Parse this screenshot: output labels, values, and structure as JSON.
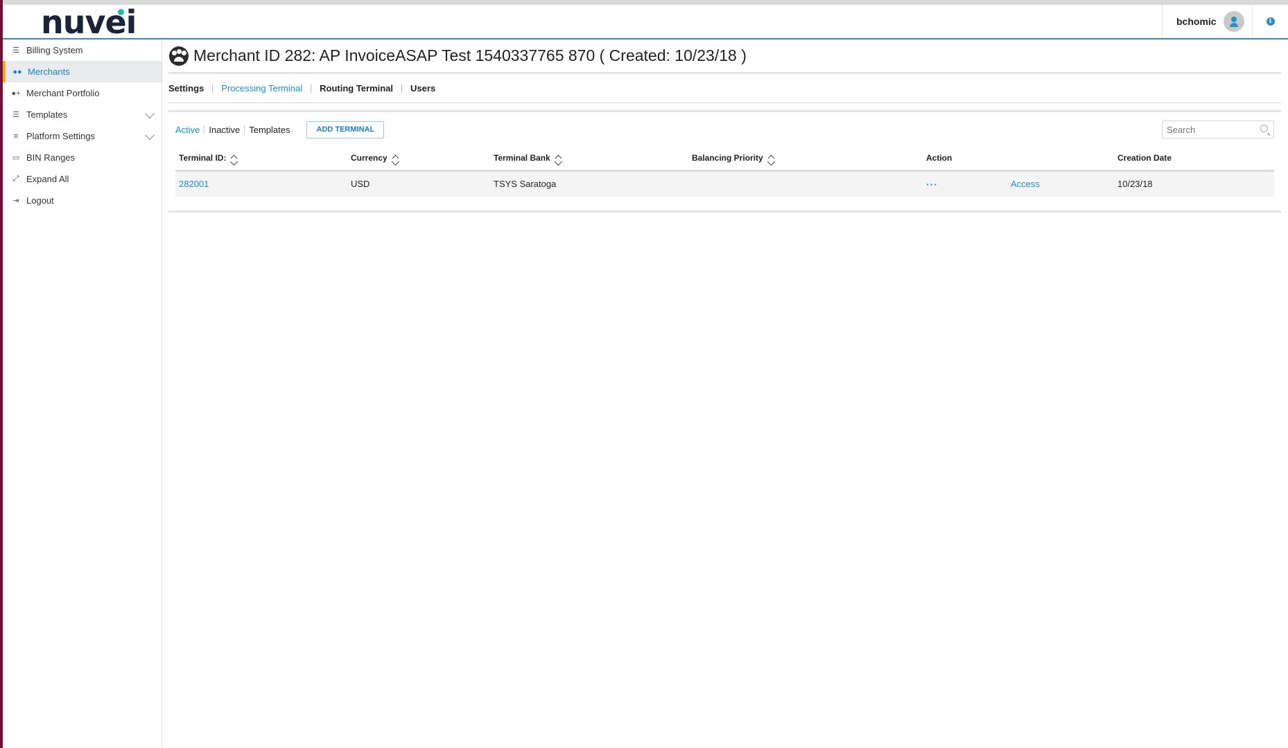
{
  "header": {
    "logo_text": "nuvei",
    "username": "bchomic",
    "info_glyph": "i"
  },
  "colors": {
    "accent": "#1a8fcf",
    "header_border": "#2a8fc7",
    "active_marker": "#f5a623",
    "logo_dark": "#1a2338",
    "logo_dot": "#26b7b0",
    "left_edge": "#6b1436"
  },
  "sidebar": {
    "items": [
      {
        "label": "Billing System",
        "icon": "list-icon"
      },
      {
        "label": "Merchants",
        "icon": "users-icon",
        "active": true
      },
      {
        "label": "Merchant Portfolio",
        "icon": "user-plus-icon"
      },
      {
        "label": "Templates",
        "icon": "list-icon",
        "expandable": true
      },
      {
        "label": "Platform Settings",
        "icon": "sliders-icon",
        "expandable": true
      },
      {
        "label": "BIN Ranges",
        "icon": "credit-card-icon"
      },
      {
        "label": "Expand All",
        "icon": "expand-icon"
      },
      {
        "label": "Logout",
        "icon": "logout-icon"
      }
    ]
  },
  "main": {
    "title": "Merchant ID 282: AP InvoiceASAP Test 1540337765 870 ( Created: 10/23/18 )",
    "tabs": [
      {
        "label": "Settings"
      },
      {
        "label": "Processing Terminal",
        "active": true
      },
      {
        "label": "Routing Terminal"
      },
      {
        "label": "Users"
      }
    ],
    "filters": [
      {
        "label": "Active",
        "active": true
      },
      {
        "label": "Inactive"
      },
      {
        "label": "Templates"
      }
    ],
    "add_button": "ADD TERMINAL",
    "search_placeholder": "Search",
    "table": {
      "columns": [
        "Terminal ID:",
        "Currency",
        "Terminal Bank",
        "Balancing Priority",
        "Action",
        "",
        "Creation Date"
      ],
      "rows": [
        {
          "terminal_id": "282001",
          "currency": "USD",
          "terminal_bank": "TSYS Saratoga",
          "balancing_priority": "",
          "action_more": "···",
          "action_access": "Access",
          "creation_date": "10/23/18"
        }
      ]
    }
  }
}
